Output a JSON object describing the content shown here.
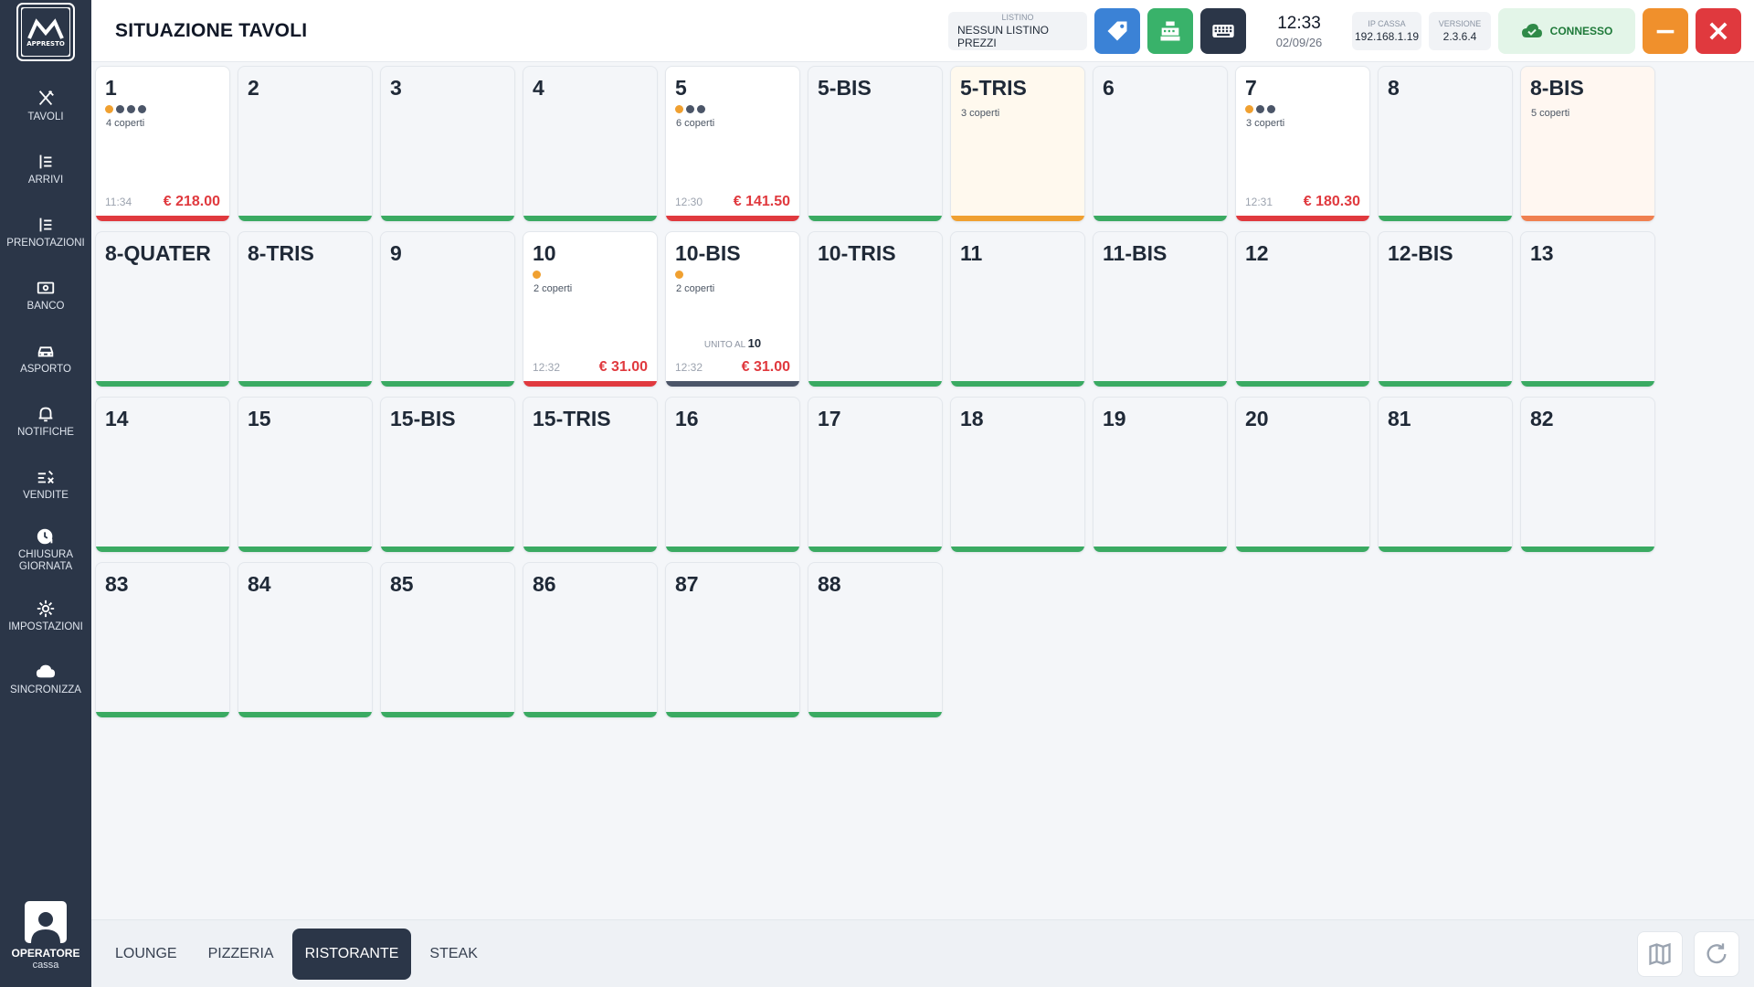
{
  "app": {
    "logo_text": "APPRESTO"
  },
  "header": {
    "title": "SITUAZIONE TAVOLI",
    "listino": {
      "label": "LISTINO",
      "value": "NESSUN LISTINO PREZZI"
    },
    "clock": {
      "time": "12:33",
      "date": "02/09/26"
    },
    "ip": {
      "label": "IP CASSA",
      "value": "192.168.1.19"
    },
    "version": {
      "label": "VERSIONE",
      "value": "2.3.6.4"
    },
    "connection": {
      "label": "CONNESSO"
    },
    "colors": {
      "tag": "#3b82d6",
      "register": "#39b26a",
      "keyboard": "#2b3648",
      "minimize": "#f0902c",
      "close": "#e0393e"
    }
  },
  "sidebar": {
    "items": [
      {
        "label": "TAVOLI",
        "icon": "utensils-icon"
      },
      {
        "label": "ARRIVI",
        "icon": "list-icon"
      },
      {
        "label": "PRENOTAZIONI",
        "icon": "list-icon"
      },
      {
        "label": "BANCO",
        "icon": "cash-icon"
      },
      {
        "label": "ASPORTO",
        "icon": "car-icon"
      },
      {
        "label": "NOTIFICHE",
        "icon": "bell-icon"
      },
      {
        "label": "VENDITE",
        "icon": "sales-icon"
      },
      {
        "label": "CHIUSURA\nGIORNATA",
        "icon": "clock-icon"
      },
      {
        "label": "IMPOSTAZIONI",
        "icon": "gear-icon"
      },
      {
        "label": "SINCRONIZZA",
        "icon": "cloud-icon"
      }
    ],
    "operator": {
      "title": "OPERATORE",
      "subtitle": "cassa"
    }
  },
  "status_colors": {
    "free": "#3aaa62",
    "occupied": "#e0393e",
    "reserved": "#f0a030",
    "reserved_late": "#f08050",
    "merged": "#4b5568"
  },
  "dot_colors": {
    "orange": "#f0a030",
    "gray": "#4b5568"
  },
  "tables": [
    {
      "name": "1",
      "status": "occupied",
      "dots": [
        "orange",
        "gray",
        "gray",
        "gray"
      ],
      "coperti": "4 coperti",
      "time": "11:34",
      "amount": "€ 218.00"
    },
    {
      "name": "2",
      "status": "free"
    },
    {
      "name": "3",
      "status": "free"
    },
    {
      "name": "4",
      "status": "free"
    },
    {
      "name": "5",
      "status": "occupied",
      "dots": [
        "orange",
        "gray",
        "gray"
      ],
      "coperti": "6 coperti",
      "time": "12:30",
      "amount": "€ 141.50"
    },
    {
      "name": "5-BIS",
      "status": "free"
    },
    {
      "name": "5-TRIS",
      "status": "reserved",
      "coperti": "3 coperti"
    },
    {
      "name": "6",
      "status": "free"
    },
    {
      "name": "7",
      "status": "occupied",
      "dots": [
        "orange",
        "gray",
        "gray"
      ],
      "coperti": "3 coperti",
      "time": "12:31",
      "amount": "€ 180.30"
    },
    {
      "name": "8",
      "status": "free"
    },
    {
      "name": "8-BIS",
      "status": "reserved_late",
      "coperti": "5 coperti"
    },
    {
      "name": "8-QUATER",
      "status": "free"
    },
    {
      "name": "8-TRIS",
      "status": "free"
    },
    {
      "name": "9",
      "status": "free"
    },
    {
      "name": "10",
      "status": "occupied",
      "dots": [
        "orange"
      ],
      "coperti": "2 coperti",
      "time": "12:32",
      "amount": "€ 31.00"
    },
    {
      "name": "10-BIS",
      "status": "merged",
      "dots": [
        "orange"
      ],
      "coperti": "2 coperti",
      "merged_label": "UNITO AL",
      "merged_with": "10",
      "time": "12:32",
      "amount": "€ 31.00"
    },
    {
      "name": "10-TRIS",
      "status": "free"
    },
    {
      "name": "11",
      "status": "free"
    },
    {
      "name": "11-BIS",
      "status": "free"
    },
    {
      "name": "12",
      "status": "free"
    },
    {
      "name": "12-BIS",
      "status": "free"
    },
    {
      "name": "13",
      "status": "free"
    },
    {
      "name": "14",
      "status": "free"
    },
    {
      "name": "15",
      "status": "free"
    },
    {
      "name": "15-BIS",
      "status": "free"
    },
    {
      "name": "15-TRIS",
      "status": "free"
    },
    {
      "name": "16",
      "status": "free"
    },
    {
      "name": "17",
      "status": "free"
    },
    {
      "name": "18",
      "status": "free"
    },
    {
      "name": "19",
      "status": "free"
    },
    {
      "name": "20",
      "status": "free"
    },
    {
      "name": "81",
      "status": "free"
    },
    {
      "name": "82",
      "status": "free"
    },
    {
      "name": "83",
      "status": "free"
    },
    {
      "name": "84",
      "status": "free"
    },
    {
      "name": "85",
      "status": "free"
    },
    {
      "name": "86",
      "status": "free"
    },
    {
      "name": "87",
      "status": "free"
    },
    {
      "name": "88",
      "status": "free"
    }
  ],
  "rooms": {
    "tabs": [
      "LOUNGE",
      "PIZZERIA",
      "RISTORANTE",
      "STEAK"
    ],
    "active": "RISTORANTE"
  },
  "bottom_icons": [
    "map-icon",
    "refresh-icon"
  ]
}
